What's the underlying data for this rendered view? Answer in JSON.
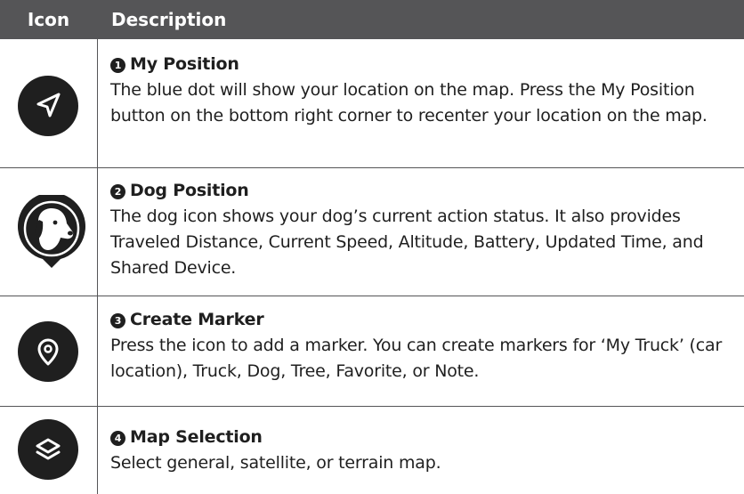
{
  "header": {
    "icon_col": "Icon",
    "desc_col": "Description"
  },
  "rows": [
    {
      "number": "1",
      "title": "My Position",
      "icon": "navigation-arrow-icon",
      "text": "The blue dot will show your location on the map. Press the My Position button on the bottom right corner to recenter your location on the map."
    },
    {
      "number": "2",
      "title": "Dog Position",
      "icon": "dog-pin-icon",
      "text": "The dog icon shows your dog’s current action status. It also provides Traveled Distance, Current Speed, Altitude, Battery, Updated Time, and Shared Device."
    },
    {
      "number": "3",
      "title": "Create Marker",
      "icon": "location-pin-icon",
      "text": "Press the icon to add a marker. You can create markers for ‘My Truck’ (car location), Truck, Dog, Tree, Favorite, or Note."
    },
    {
      "number": "4",
      "title": "Map Selection",
      "icon": "layers-icon",
      "text": "Select general, satellite, or terrain map."
    }
  ],
  "colors": {
    "header_bg": "#555557",
    "icon_bg": "#1f1f1f",
    "text": "#1f1f1f"
  }
}
